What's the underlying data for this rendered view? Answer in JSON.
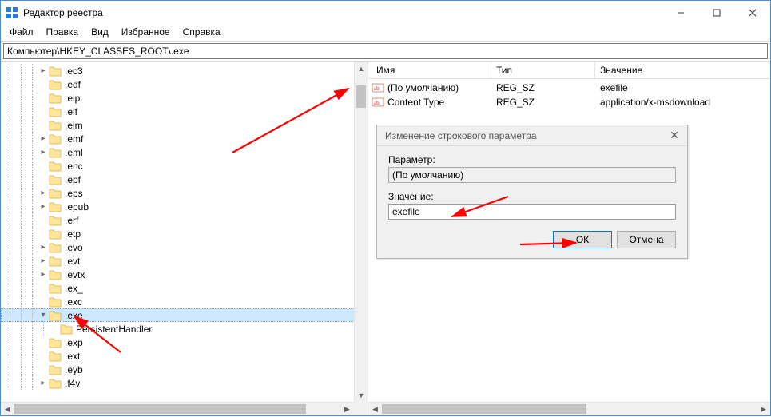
{
  "window": {
    "title": "Редактор реестра"
  },
  "menu": {
    "file": "Файл",
    "edit": "Правка",
    "view": "Вид",
    "favorites": "Избранное",
    "help": "Справка"
  },
  "address": {
    "value": "Компьютер\\HKEY_CLASSES_ROOT\\.exe"
  },
  "tree": {
    "items": [
      {
        "label": ".ec3",
        "depth": 3,
        "twisty": ">"
      },
      {
        "label": ".edf",
        "depth": 3,
        "twisty": ""
      },
      {
        "label": ".eip",
        "depth": 3,
        "twisty": ""
      },
      {
        "label": ".elf",
        "depth": 3,
        "twisty": ""
      },
      {
        "label": ".elm",
        "depth": 3,
        "twisty": ""
      },
      {
        "label": ".emf",
        "depth": 3,
        "twisty": ">"
      },
      {
        "label": ".eml",
        "depth": 3,
        "twisty": ">"
      },
      {
        "label": ".enc",
        "depth": 3,
        "twisty": ""
      },
      {
        "label": ".epf",
        "depth": 3,
        "twisty": ""
      },
      {
        "label": ".eps",
        "depth": 3,
        "twisty": ">"
      },
      {
        "label": ".epub",
        "depth": 3,
        "twisty": ">"
      },
      {
        "label": ".erf",
        "depth": 3,
        "twisty": ""
      },
      {
        "label": ".etp",
        "depth": 3,
        "twisty": ""
      },
      {
        "label": ".evo",
        "depth": 3,
        "twisty": ">"
      },
      {
        "label": ".evt",
        "depth": 3,
        "twisty": ">"
      },
      {
        "label": ".evtx",
        "depth": 3,
        "twisty": ">"
      },
      {
        "label": ".ex_",
        "depth": 3,
        "twisty": ""
      },
      {
        "label": ".exc",
        "depth": 3,
        "twisty": ""
      },
      {
        "label": ".exe",
        "depth": 3,
        "twisty": "v",
        "selected": true
      },
      {
        "label": "PersistentHandler",
        "depth": 4,
        "twisty": ""
      },
      {
        "label": ".exp",
        "depth": 3,
        "twisty": ""
      },
      {
        "label": ".ext",
        "depth": 3,
        "twisty": ""
      },
      {
        "label": ".eyb",
        "depth": 3,
        "twisty": ""
      },
      {
        "label": ".f4v",
        "depth": 3,
        "twisty": ">"
      }
    ]
  },
  "list": {
    "headers": {
      "name": "Имя",
      "type": "Тип",
      "value": "Значение"
    },
    "rows": [
      {
        "name": "(По умолчанию)",
        "type": "REG_SZ",
        "value": "exefile"
      },
      {
        "name": "Content Type",
        "type": "REG_SZ",
        "value": "application/x-msdownload"
      }
    ]
  },
  "dialog": {
    "title": "Изменение строкового параметра",
    "param_label": "Параметр:",
    "param_value": "(По умолчанию)",
    "value_label": "Значение:",
    "value_value": "exefile",
    "ok": "ОК",
    "cancel": "Отмена"
  }
}
